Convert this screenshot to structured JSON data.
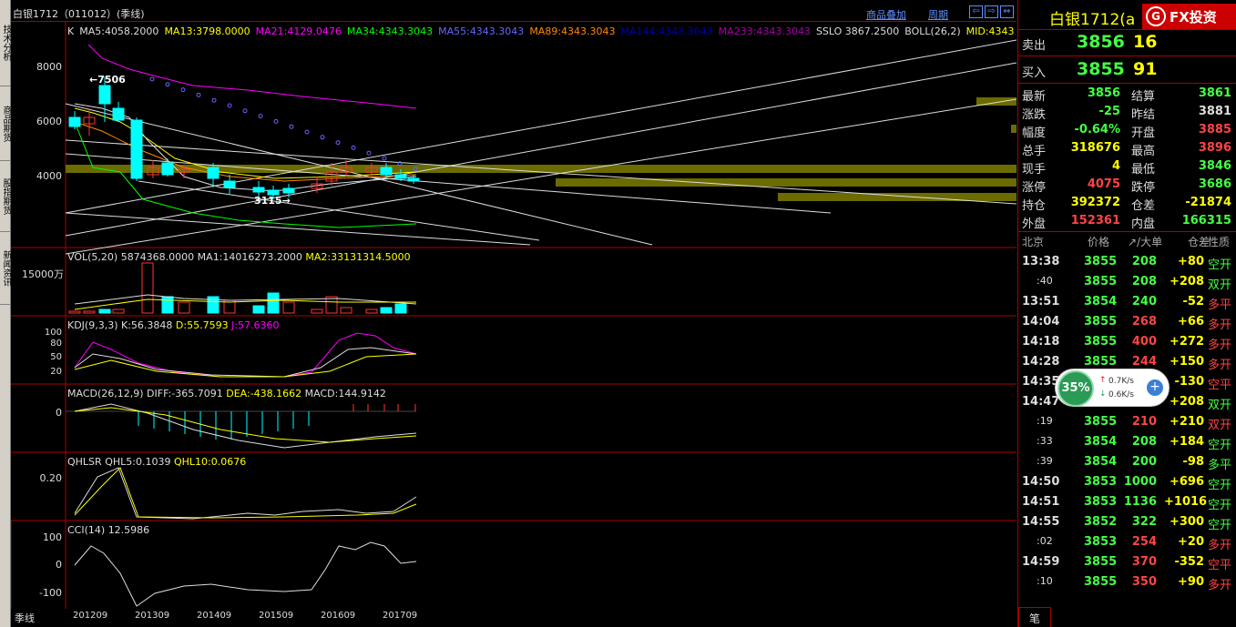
{
  "window": {
    "title": "白银1712（011012）(季线)",
    "links": [
      "商品叠加",
      "周期"
    ],
    "nav": [
      "⇦",
      "⇨",
      "⇔"
    ]
  },
  "sidebar": [
    "技术分析",
    "商品期货",
    "股指期货",
    "新闻资讯"
  ],
  "kline": {
    "label": "K",
    "indicators": [
      {
        "t": "MA5:4058.2000",
        "c": "#ddd"
      },
      {
        "t": "MA13:3798.0000",
        "c": "#ff0"
      },
      {
        "t": "MA21:4129.0476",
        "c": "#f0f"
      },
      {
        "t": "MA34:4343.3043",
        "c": "#0f0"
      },
      {
        "t": "MA55:4343.3043",
        "c": "#66f"
      },
      {
        "t": "MA89:4343.3043",
        "c": "#f80"
      },
      {
        "t": "MA144:4343.3043",
        "c": "#00a"
      },
      {
        "t": "MA233:4343.3043",
        "c": "#a0a"
      },
      {
        "t": "SSLO 3867.2500",
        "c": "#ddd"
      },
      {
        "t": "BOLL(26,2)",
        "c": "#ddd"
      },
      {
        "t": "MID:4343",
        "c": "#ff0"
      }
    ],
    "yticks": [
      "8000",
      "6000",
      "4000"
    ],
    "high_note": "←7506",
    "low_note": "3115→"
  },
  "vol": {
    "label": "VOL(5,20) 5874368.0000",
    "ma1": "MA1:14016273.2000",
    "ma2": "MA2:33131314.5000",
    "ytick": "15000万"
  },
  "kdj": {
    "label": "KDJ(9,3,3)",
    "k": "K:56.3848",
    "d": "D:55.7593",
    "j": "J:57.6360",
    "yticks": [
      "100",
      "80",
      "50",
      "20"
    ]
  },
  "macd": {
    "label": "MACD(26,12,9)",
    "diff": "DIFF:-365.7091",
    "dea": "DEA:-438.1662",
    "macd": "MACD:144.9142",
    "ytick": "0"
  },
  "qhlsr": {
    "label": "QHLSR",
    "q5": "QHL5:0.1039",
    "q10": "QHL10:0.0676",
    "ytick": "0.20"
  },
  "cci": {
    "label": "CCI(14)",
    "value": "12.5986",
    "yticks": [
      "100",
      "0",
      "-100"
    ]
  },
  "xaxis": {
    "period": "季线",
    "labels": [
      "201209",
      "201309",
      "201409",
      "201509",
      "201609",
      "201709"
    ]
  },
  "quote": {
    "name": "白银1712",
    "name_suffix": "(a",
    "brand": "FX投资",
    "sell_label": "卖出",
    "sell_price": "3856",
    "sell_vol": "16",
    "buy_label": "买入",
    "buy_price": "3855",
    "buy_vol": "91",
    "stats": [
      [
        "最新",
        "3856",
        "g",
        "结算",
        "3861",
        "g"
      ],
      [
        "涨跌",
        "-25",
        "g",
        "昨结",
        "3881",
        "w"
      ],
      [
        "幅度",
        "-0.64%",
        "g",
        "开盘",
        "3885",
        "r"
      ],
      [
        "总手",
        "318676",
        "y",
        "最高",
        "3896",
        "r"
      ],
      [
        "现手",
        "4",
        "y",
        "最低",
        "3846",
        "g"
      ],
      [
        "涨停",
        "4075",
        "r",
        "跌停",
        "3686",
        "g"
      ],
      [
        "持仓",
        "392372",
        "y",
        "仓差",
        "-21874",
        "y"
      ],
      [
        "外盘",
        "152361",
        "r",
        "内盘",
        "166315",
        "g"
      ]
    ]
  },
  "ticks_header": [
    "北京",
    "价格",
    "↗/大单",
    "仓差",
    "性质"
  ],
  "ticks": [
    [
      "13:38",
      "3855",
      "208",
      "+80",
      "空开",
      "g",
      "g",
      "g"
    ],
    [
      ":40",
      "3855",
      "208",
      "+208",
      "双开",
      "g",
      "g",
      "g"
    ],
    [
      "13:51",
      "3854",
      "240",
      "-52",
      "多平",
      "g",
      "g",
      "r"
    ],
    [
      "14:04",
      "3855",
      "268",
      "+66",
      "多开",
      "g",
      "r",
      "r"
    ],
    [
      "14:18",
      "3855",
      "400",
      "+272",
      "多开",
      "g",
      "r",
      "r"
    ],
    [
      "14:28",
      "3855",
      "244",
      "+150",
      "多开",
      "g",
      "r",
      "r"
    ],
    [
      "14:35",
      "3855",
      "",
      "-130",
      "空平",
      "g",
      "r",
      "r"
    ],
    [
      "14:47",
      "3855",
      "",
      "+208",
      "双开",
      "g",
      "r",
      "g"
    ],
    [
      ":19",
      "3855",
      "210",
      "+210",
      "双开",
      "g",
      "r",
      "r"
    ],
    [
      ":33",
      "3854",
      "208",
      "+184",
      "空开",
      "g",
      "g",
      "g"
    ],
    [
      ":39",
      "3854",
      "200",
      "-98",
      "多平",
      "g",
      "g",
      "g"
    ],
    [
      "14:50",
      "3853",
      "1000",
      "+696",
      "空开",
      "g",
      "g",
      "g"
    ],
    [
      "14:51",
      "3853",
      "1136",
      "+1016",
      "空开",
      "g",
      "g",
      "g"
    ],
    [
      "14:55",
      "3852",
      "322",
      "+300",
      "空开",
      "g",
      "g",
      "g"
    ],
    [
      ":02",
      "3853",
      "254",
      "+20",
      "多开",
      "g",
      "r",
      "r"
    ],
    [
      "14:59",
      "3855",
      "370",
      "-352",
      "空平",
      "g",
      "r",
      "r"
    ],
    [
      ":10",
      "3855",
      "350",
      "+90",
      "多开",
      "g",
      "r",
      "r"
    ]
  ],
  "badge": {
    "pct": "35%",
    "up": "0.7K/s",
    "down": "0.6K/s"
  },
  "bottom_tab": "笔"
}
